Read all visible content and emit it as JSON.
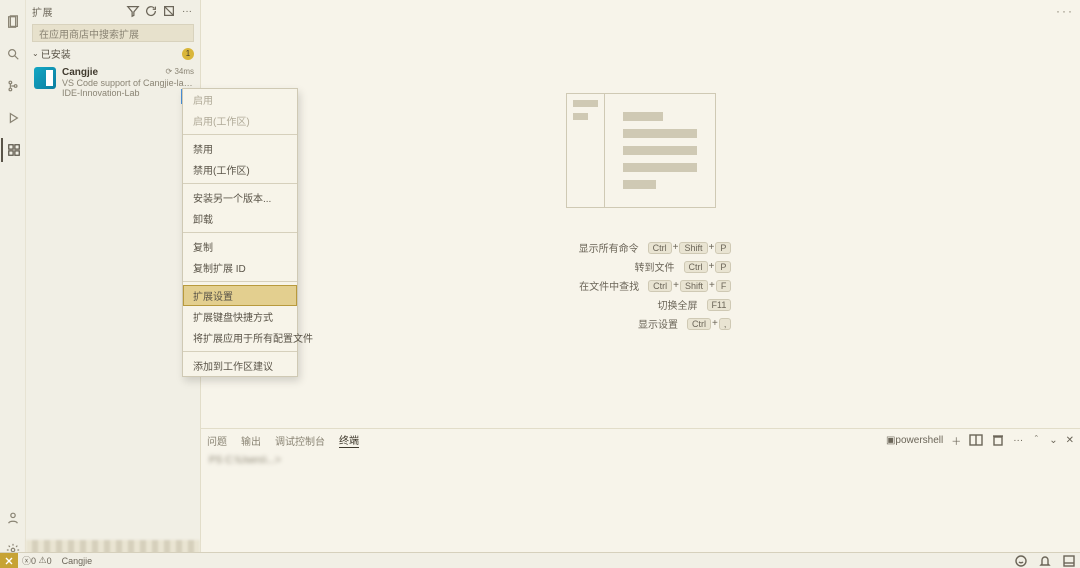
{
  "sidebar": {
    "title": "扩展",
    "search_placeholder": "在应用商店中搜索扩展",
    "section": {
      "label": "已安装",
      "count": "1"
    },
    "extension": {
      "name": "Cangjie",
      "description": "VS Code support of Cangjie-language",
      "publisher": "IDE-Innovation-Lab",
      "time": "34ms"
    }
  },
  "ctx": {
    "enable": "启用",
    "enable_ws": "启用(工作区)",
    "disable": "禁用",
    "disable_ws": "禁用(工作区)",
    "install_other": "安装另一个版本...",
    "uninstall": "卸载",
    "copy": "复制",
    "copy_id": "复制扩展 ID",
    "settings": "扩展设置",
    "keybindings": "扩展键盘快捷方式",
    "apply_all_profiles": "将扩展应用于所有配置文件",
    "add_ws_rec": "添加到工作区建议"
  },
  "welcome": {
    "r1": {
      "label": "显示所有命令",
      "keys": [
        "Ctrl",
        "Shift",
        "P"
      ]
    },
    "r2": {
      "label": "转到文件",
      "keys": [
        "Ctrl",
        "P"
      ]
    },
    "r3": {
      "label": "在文件中查找",
      "keys": [
        "Ctrl",
        "Shift",
        "F"
      ]
    },
    "r4": {
      "label": "切换全屏",
      "keys": [
        "F11"
      ]
    },
    "r5": {
      "label": "显示设置",
      "keys": [
        "Ctrl",
        ","
      ]
    }
  },
  "panel": {
    "tabs": {
      "problems": "问题",
      "output": "输出",
      "debug": "调试控制台",
      "terminal": "终端"
    },
    "shell": "powershell",
    "prompt": "PS C:\\Users\\...> "
  },
  "status": {
    "errors": "0",
    "warnings": "0",
    "lang": "Cangjie"
  }
}
